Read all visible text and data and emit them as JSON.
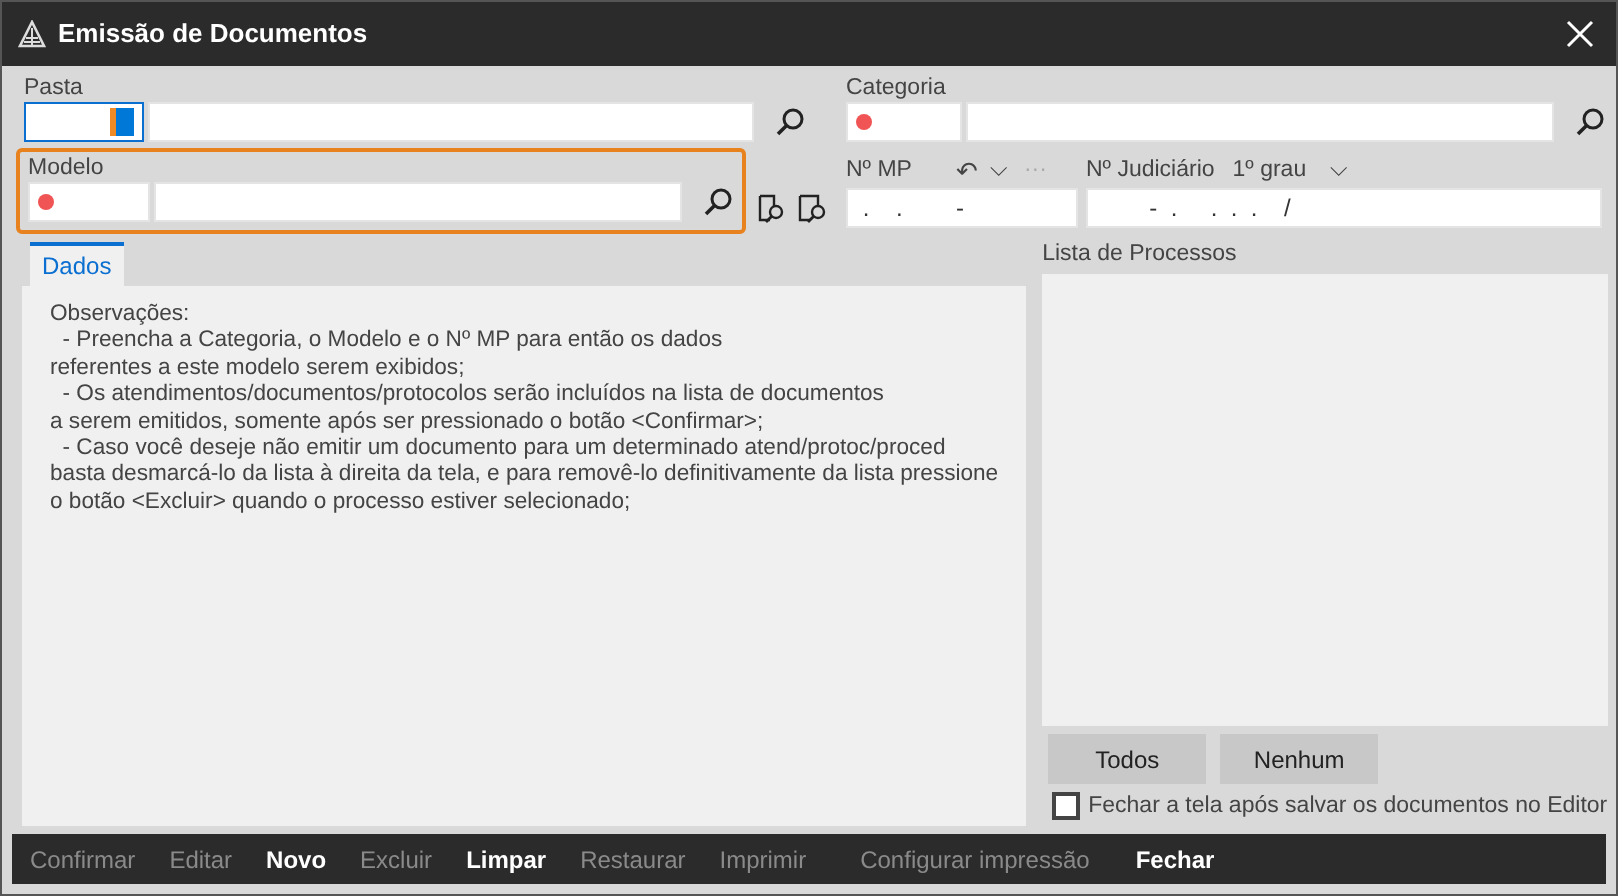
{
  "window": {
    "title": "Emissão de Documentos"
  },
  "pasta": {
    "label": "Pasta",
    "code": {
      "required": false,
      "focused": true
    }
  },
  "categoria": {
    "label": "Categoria",
    "code": {
      "required": true,
      "focused": false
    }
  },
  "modelo": {
    "label": "Modelo",
    "highlighted": true,
    "code": {
      "required": true,
      "focused": false
    }
  },
  "mp": {
    "label": "Nº MP",
    "undo": "↶",
    "caret": "⌵",
    "more": "···",
    "value": " .    .        -"
  },
  "judiciario": {
    "label": "Nº Judiciário",
    "grau": "1º grau",
    "caret": "⌵",
    "value": "        -  .     .  .  .    /"
  },
  "tabs": [
    {
      "label": "Dados",
      "selected": true
    }
  ],
  "observacoes": [
    "Observações:",
    "  - Preencha a Categoria, o Modelo e o Nº MP para então os dados",
    "referentes a este modelo serem exibidos;",
    "  - Os atendimentos/documentos/protocolos serão incluídos na lista de documentos",
    "a serem emitidos, somente após ser pressionado o botão <Confirmar>;",
    "  - Caso você deseje não emitir um documento para um determinado atend/protoc/proced",
    "basta desmarcá-lo da lista à direita da tela, e para removê-lo definitivamente da lista pressione",
    "o botão <Excluir> quando o processo estiver selecionado;"
  ],
  "lista": {
    "label": "Lista de Processos"
  },
  "lista_buttons": [
    "Todos",
    "Nenhum"
  ],
  "close_option": {
    "label": "Fechar a tela após salvar os documentos no Editor",
    "checked": false
  },
  "toolbar": [
    {
      "label": "Confirmar",
      "disabled": true
    },
    {
      "label": "Editar",
      "disabled": true
    },
    {
      "label": "Novo",
      "disabled": false
    },
    {
      "label": "Excluir",
      "disabled": true
    },
    {
      "label": "Limpar",
      "disabled": false
    },
    {
      "label": "Restaurar",
      "disabled": true
    },
    {
      "label": "Imprimir",
      "disabled": true
    },
    {
      "label": "Configurar impressão",
      "disabled": true
    },
    {
      "label": "Fechar",
      "disabled": false
    }
  ]
}
